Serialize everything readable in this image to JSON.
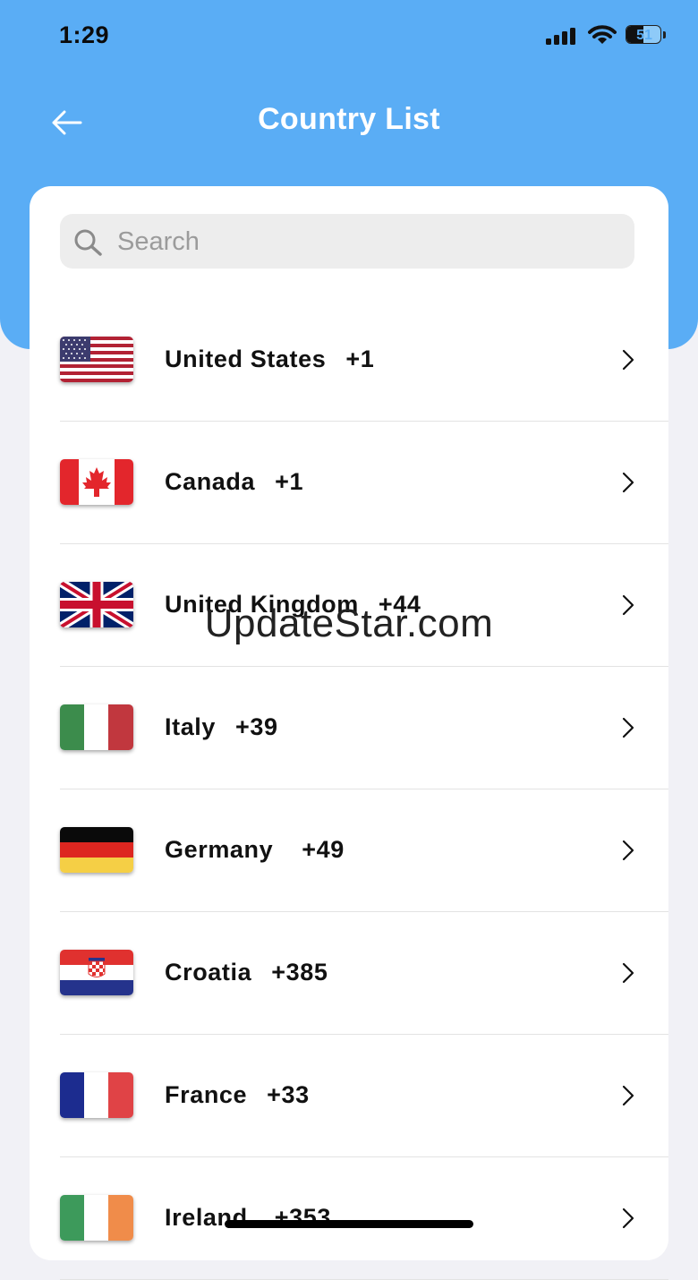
{
  "status_bar": {
    "time": "1:29",
    "battery_level": "51",
    "battery_fraction": 0.51,
    "icons": [
      "signal-icon",
      "wifi-icon",
      "battery-icon"
    ]
  },
  "header": {
    "title": "Country List",
    "back_icon": "back-arrow-icon",
    "background_color": "#5aadf5",
    "title_color": "#ffffff"
  },
  "search": {
    "placeholder": "Search",
    "value": "",
    "icon": "search-icon"
  },
  "countries": [
    {
      "name": "United States",
      "code": "+1",
      "flag": "us-flag-icon"
    },
    {
      "name": "Canada",
      "code": "+1",
      "flag": "canada-flag-icon"
    },
    {
      "name": "United Kingdom",
      "code": "+44",
      "flag": "uk-flag-icon"
    },
    {
      "name": "Italy",
      "code": "+39",
      "flag": "italy-flag-icon"
    },
    {
      "name": "Germany",
      "code": "+49",
      "flag": "germany-flag-icon"
    },
    {
      "name": "Croatia",
      "code": "+385",
      "flag": "croatia-flag-icon"
    },
    {
      "name": "France",
      "code": "+33",
      "flag": "france-flag-icon"
    },
    {
      "name": "Ireland",
      "code": "+353",
      "flag": "ireland-flag-icon"
    }
  ],
  "watermark": "UpdateStar.com"
}
